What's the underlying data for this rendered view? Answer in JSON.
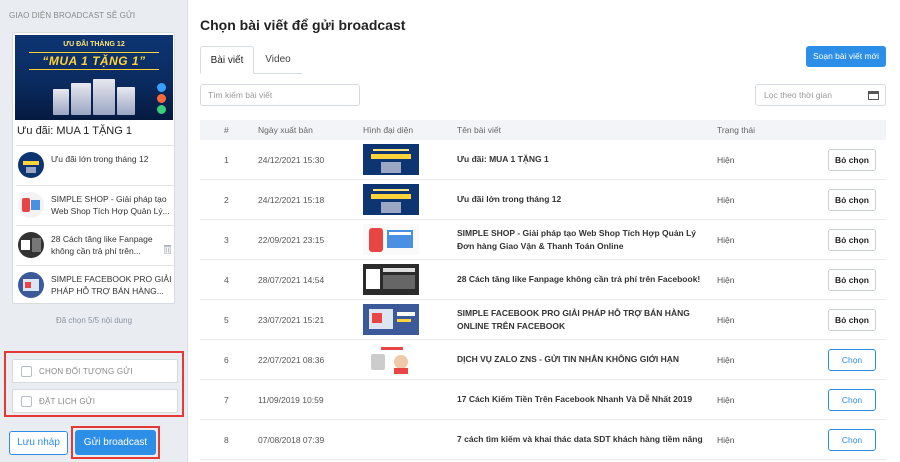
{
  "sidebar": {
    "section_title": "GIAO DIỆN BROADCAST SẼ GỬI",
    "banner": {
      "top_text": "ƯU ĐÃI THÁNG 12",
      "main_text": "“MUA 1 TẶNG 1”"
    },
    "featured_title": "Ưu đãi: MUA 1 TẶNG 1",
    "items": [
      {
        "line1": "Ưu đãi lớn trong tháng 12",
        "line2": ""
      },
      {
        "line1": "SIMPLE SHOP - Giải pháp tạo",
        "line2": "Web Shop Tích Hợp Quản Lý..."
      },
      {
        "line1": "28 Cách tăng like Fanpage",
        "line2": "không cần trả phí trên..."
      },
      {
        "line1": "SIMPLE FACEBOOK PRO GIẢI",
        "line2": "PHÁP HỖ TRỢ BÁN HÀNG..."
      }
    ],
    "selected_count": "Đã chọn 5/5 nội dung",
    "options": {
      "choose_audience": "CHỌN ĐỐI TƯỢNG GỬI",
      "schedule": "ĐẶT LỊCH GỬI"
    },
    "draft_label": "Lưu nháp",
    "send_label": "Gửi broadcast"
  },
  "main": {
    "title": "Chọn bài viết để gửi broadcast",
    "tabs": [
      {
        "label": "Bài viết"
      },
      {
        "label": "Video"
      }
    ],
    "compose_label": "Soạn bài viết mới",
    "search_placeholder": "Tìm kiếm bài viết",
    "date_filter_placeholder": "Lọc theo thời gian",
    "columns": {
      "index": "#",
      "date": "Ngày xuất bản",
      "image": "Hình đại diện",
      "title": "Tên bài viết",
      "status": "Trạng thái"
    },
    "rows": [
      {
        "index": "1",
        "date": "24/12/2021 15:30",
        "title1": "Ưu đãi: MUA 1 TẶNG 1",
        "title2": "",
        "status": "Hiện",
        "action": "Bỏ chọn",
        "selected": true
      },
      {
        "index": "2",
        "date": "24/12/2021 15:18",
        "title1": "Ưu đãi lớn trong tháng 12",
        "title2": "",
        "status": "Hiện",
        "action": "Bỏ chọn",
        "selected": true
      },
      {
        "index": "3",
        "date": "22/09/2021 23:15",
        "title1": "SIMPLE SHOP - Giải pháp tạo Web Shop Tích Hợp Quản Lý",
        "title2": "Đơn hàng Giao Vận & Thanh Toán Online",
        "status": "Hiện",
        "action": "Bỏ chọn",
        "selected": true
      },
      {
        "index": "4",
        "date": "28/07/2021 14:54",
        "title1": "28 Cách tăng like Fanpage không cần trả phí trên Facebook!",
        "title2": "",
        "status": "Hiện",
        "action": "Bỏ chọn",
        "selected": true
      },
      {
        "index": "5",
        "date": "23/07/2021 15:21",
        "title1": "SIMPLE FACEBOOK PRO GIẢI PHÁP HỖ TRỢ BÁN HÀNG",
        "title2": "ONLINE TRÊN FACEBOOK",
        "status": "Hiện",
        "action": "Bỏ chọn",
        "selected": true
      },
      {
        "index": "6",
        "date": "22/07/2021 08:36",
        "title1": "DỊCH VỤ ZALO ZNS - GỬI TIN NHẮN KHÔNG GIỚI HẠN",
        "title2": "",
        "status": "Hiện",
        "action": "Chọn",
        "selected": false
      },
      {
        "index": "7",
        "date": "11/09/2019 10:59",
        "title1": "17 Cách Kiếm Tiền Trên Facebook Nhanh Và Dễ Nhất 2019",
        "title2": "",
        "status": "Hiện",
        "action": "Chọn",
        "selected": false
      },
      {
        "index": "8",
        "date": "07/08/2018 07:39",
        "title1": "7 cách tìm kiếm và khai thác data SDT khách hàng tiềm năng",
        "title2": "",
        "status": "Hiện",
        "action": "Chọn",
        "selected": false
      }
    ]
  }
}
